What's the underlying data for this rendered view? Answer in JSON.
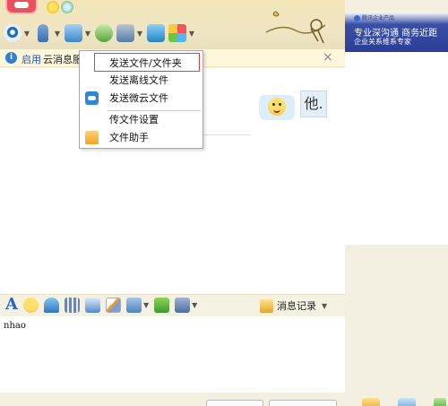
{
  "notice": {
    "link": "启用",
    "text": "云消息服",
    "close": "×"
  },
  "chat": {
    "timestamp": "12",
    "avatar_text": "他."
  },
  "file_menu": {
    "items": [
      {
        "label": "发送文件/文件夹",
        "highlighted": true
      },
      {
        "label": "发送离线文件"
      },
      {
        "label": "发送微云文件",
        "icon": "weiyun-cloud-icon"
      },
      {
        "label": "传文件设置"
      },
      {
        "label": "文件助手",
        "icon": "folder-icon"
      }
    ]
  },
  "ad": {
    "logo": "腾讯企业产品",
    "line1": "专业深沟通 商务近距",
    "line2": "企业关系维系专家"
  },
  "input_toolbar": {
    "history_label": "消息记录"
  },
  "input": {
    "text": "nhao"
  },
  "colors": {
    "accent": "#2f86d6",
    "highlight_border": "#e24141",
    "banner": "#f2e6b8",
    "ad_blue": "#2a3e97"
  }
}
